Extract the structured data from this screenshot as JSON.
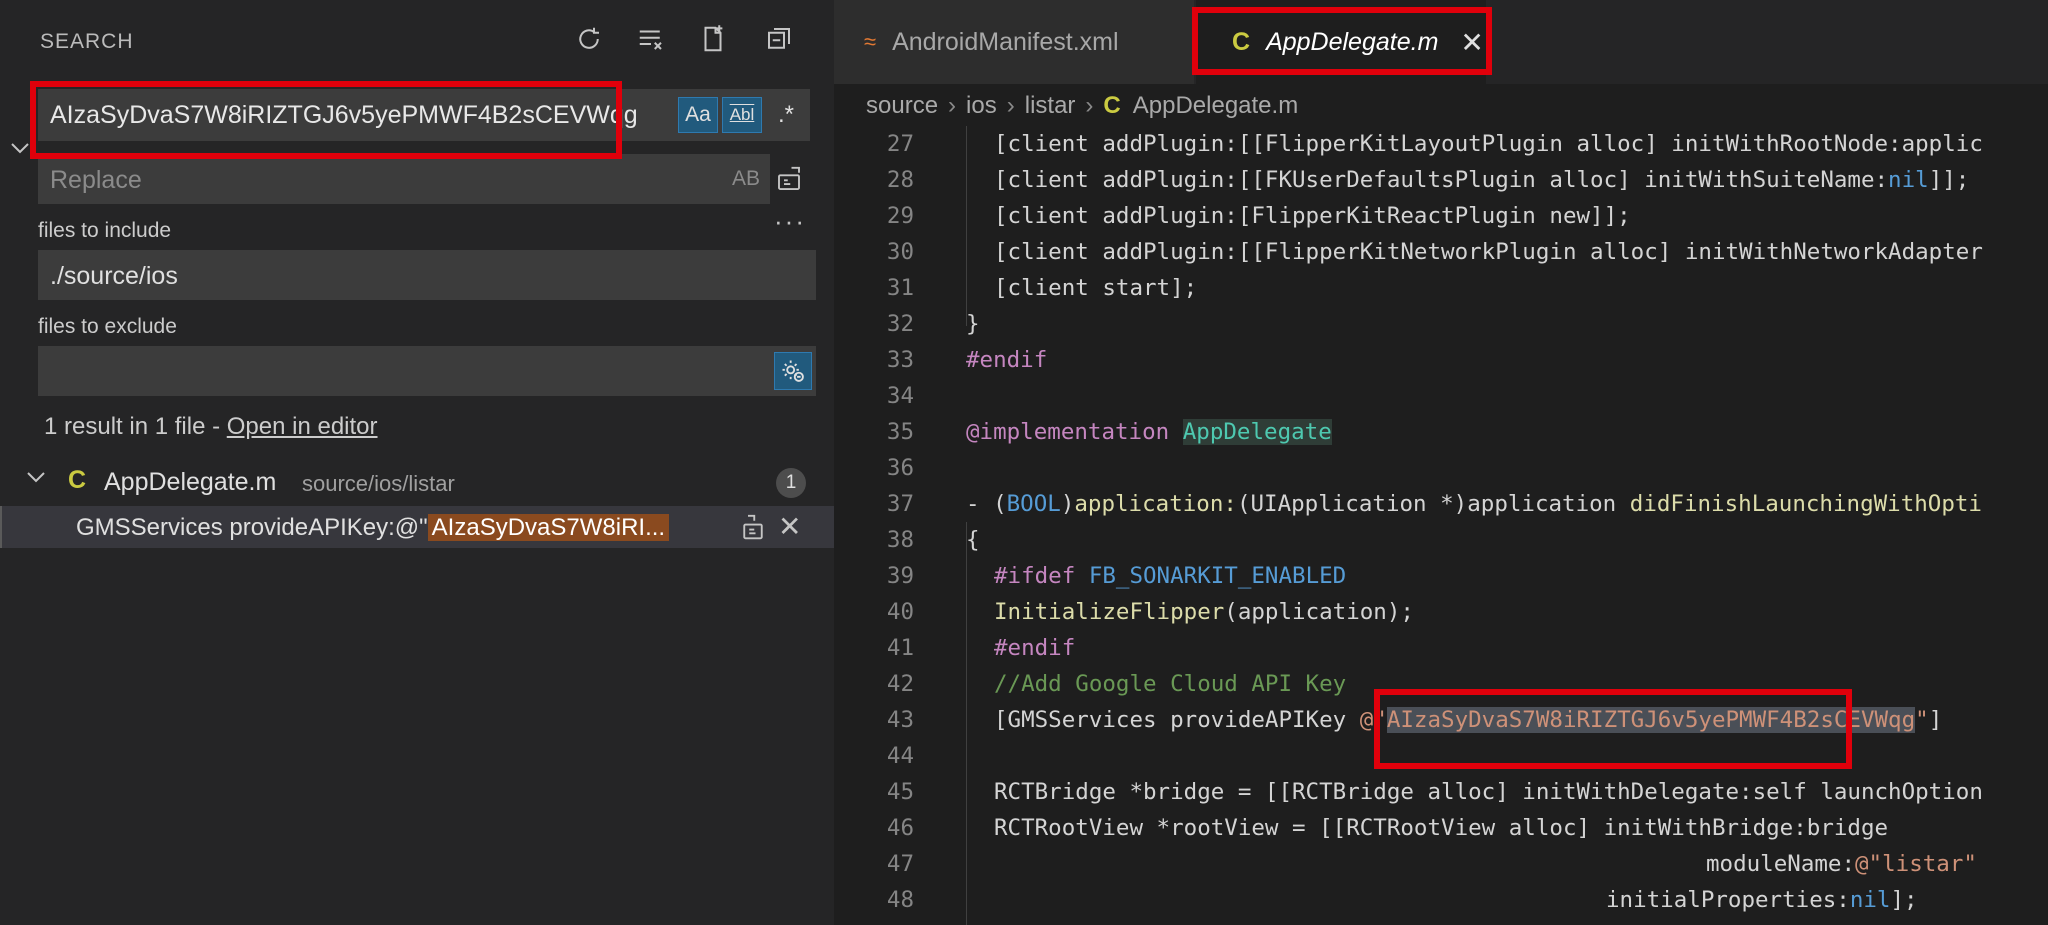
{
  "sidebar": {
    "title": "SEARCH",
    "search": {
      "value": "AIzaSyDvaS7W8iRIZTGJ6v5yePMWF4B2sCEVWqg"
    },
    "options": {
      "match_case": "Aa",
      "whole_word": "Abl",
      "regex": ".*"
    },
    "replace": {
      "placeholder": "Replace",
      "preserve_case": "AB"
    },
    "files_to_include": {
      "label": "files to include",
      "value": "./source/ios"
    },
    "files_to_exclude": {
      "label": "files to exclude",
      "value": ""
    },
    "summary": {
      "text": "1 result in 1 file - ",
      "link": "Open in editor"
    },
    "results": {
      "file_icon": "C",
      "file_name": "AppDelegate.m",
      "file_path": "source/ios/listar",
      "count": "1",
      "match_prefix": "GMSServices provideAPIKey:@\"",
      "match_highlight": "AIzaSyDvaS7W8iRI..."
    }
  },
  "editor": {
    "tabs": [
      {
        "icon": "≈",
        "label": "AndroidManifest.xml"
      },
      {
        "icon": "C",
        "label": "AppDelegate.m"
      }
    ],
    "breadcrumbs": [
      "source",
      "ios",
      "listar",
      "AppDelegate.m"
    ],
    "breadcrumb_icon": "C"
  },
  "code_lines": [
    {
      "n": "27",
      "t": "[client addPlugin:[[FlipperKitLayoutPlugin alloc] initWithRootNode:applic"
    },
    {
      "n": "28",
      "t": "[client addPlugin:[[FKUserDefaultsPlugin alloc] initWithSuiteName:nil]];"
    },
    {
      "n": "29",
      "t": "[client addPlugin:[FlipperKitReactPlugin new]];"
    },
    {
      "n": "30",
      "t": "[client addPlugin:[[FlipperKitNetworkPlugin alloc] initWithNetworkAdapter"
    },
    {
      "n": "31",
      "t": "[client start];"
    },
    {
      "n": "32",
      "t": "}"
    },
    {
      "n": "33",
      "t": "#endif"
    },
    {
      "n": "34",
      "t": ""
    },
    {
      "n": "35",
      "t": "@implementation AppDelegate"
    },
    {
      "n": "36",
      "t": ""
    },
    {
      "n": "37",
      "t": "- (BOOL)application:(UIApplication *)application didFinishLaunchingWithOpti"
    },
    {
      "n": "38",
      "t": "{"
    },
    {
      "n": "39",
      "t": "#ifdef FB_SONARKIT_ENABLED"
    },
    {
      "n": "40",
      "t": "InitializeFlipper(application);"
    },
    {
      "n": "41",
      "t": "#endif"
    },
    {
      "n": "42",
      "t": "//Add Google Cloud API Key"
    },
    {
      "n": "43",
      "t": "[GMSServices provideAPIKey @\"AIzaSyDvaS7W8iRIZTGJ6v5yePMWF4B2sCEVWqg\"]"
    },
    {
      "n": "44",
      "t": ""
    },
    {
      "n": "45",
      "t": "RCTBridge *bridge = [[RCTBridge alloc] initWithDelegate:self launchOption"
    },
    {
      "n": "46",
      "t": "RCTRootView *rootView = [[RCTRootView alloc] initWithBridge:bridge"
    },
    {
      "n": "47",
      "t": "moduleName:@\"listar\""
    },
    {
      "n": "48",
      "t": "initialProperties:nil];"
    }
  ]
}
